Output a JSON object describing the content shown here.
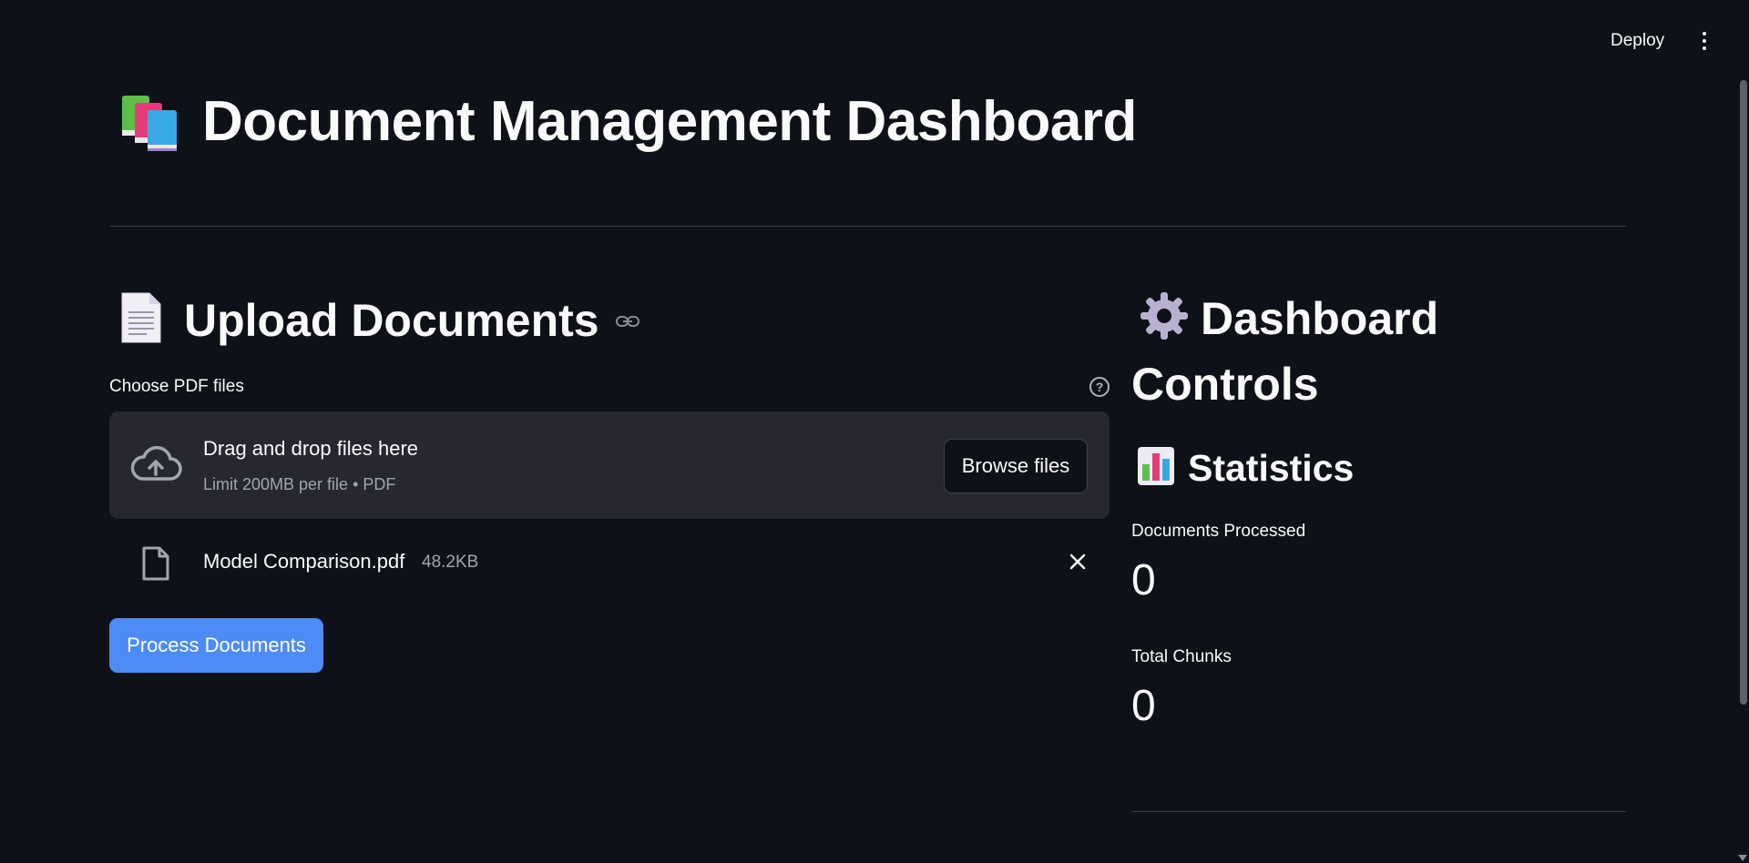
{
  "header": {
    "deploy_label": "Deploy",
    "menu_icon": "more-vertical-icon"
  },
  "page": {
    "title": "Document Management Dashboard",
    "title_icon": "books-icon"
  },
  "upload": {
    "section_title": "Upload Documents",
    "section_icon": "page-icon",
    "uploader_label": "Choose PDF files",
    "drop_text": "Drag and drop files here",
    "drop_limit": "Limit 200MB per file • PDF",
    "browse_label": "Browse files",
    "files": [
      {
        "name": "Model Comparison.pdf",
        "size": "48.2KB"
      }
    ],
    "process_label": "Process Documents"
  },
  "controls": {
    "title": "Dashboard Controls",
    "title_icon": "gear-icon",
    "stats_title": "Statistics",
    "stats_icon": "bar-chart-icon",
    "metrics": [
      {
        "label": "Documents Processed",
        "value": "0"
      },
      {
        "label": "Total Chunks",
        "value": "0"
      }
    ]
  },
  "colors": {
    "background": "#0e1117",
    "surface": "#262730",
    "primary": "#4d8cf5",
    "text": "#fafafa",
    "muted": "#a3a5ad"
  }
}
